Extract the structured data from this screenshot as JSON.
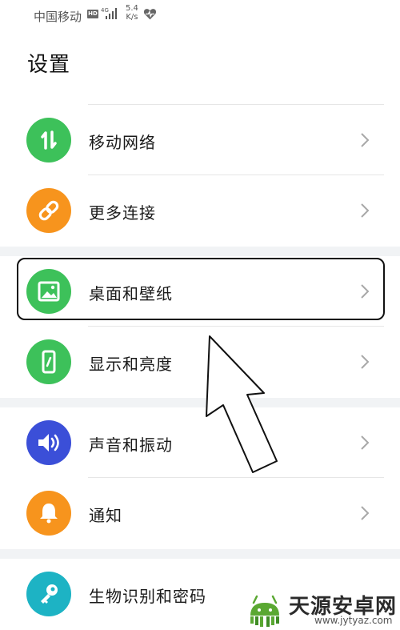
{
  "status_bar": {
    "carrier": "中国移动",
    "hd": "HD",
    "network": "4G",
    "speed_value": "5.4",
    "speed_unit": "K/s",
    "icons": [
      "signal-icon",
      "heart-rate-icon"
    ]
  },
  "header": {
    "title": "设置"
  },
  "settings": [
    {
      "label": "移动网络",
      "icon": "mobile-data-icon",
      "color": "#3dc15a"
    },
    {
      "label": "更多连接",
      "icon": "link-icon",
      "color": "#f7941d"
    },
    {
      "label": "桌面和壁纸",
      "icon": "wallpaper-icon",
      "color": "#3dc15a"
    },
    {
      "label": "显示和亮度",
      "icon": "display-brightness-icon",
      "color": "#3dc15a"
    },
    {
      "label": "声音和振动",
      "icon": "speaker-icon",
      "color": "#3b4fd8"
    },
    {
      "label": "通知",
      "icon": "bell-icon",
      "color": "#f7941d"
    },
    {
      "label": "生物识别和密码",
      "icon": "key-icon",
      "color": "#1db3c4"
    }
  ],
  "watermark": {
    "name": "天源安卓网",
    "url": "www.jytyaz.com"
  }
}
